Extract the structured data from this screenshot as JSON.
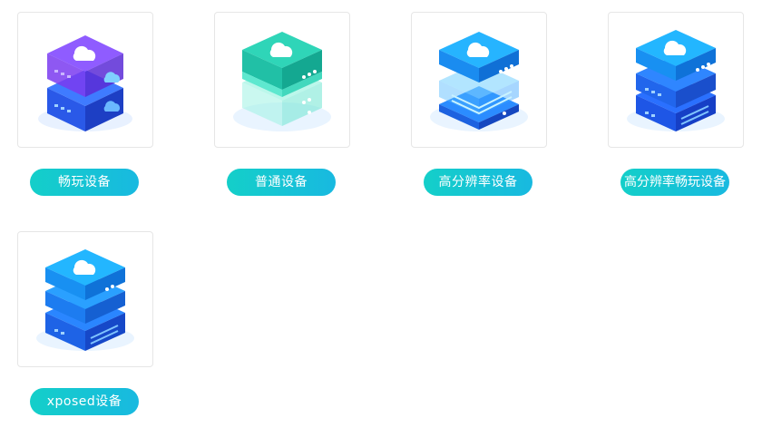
{
  "devices": [
    {
      "label": "畅玩设备",
      "icon": "server-cube-purple-icon"
    },
    {
      "label": "普通设备",
      "icon": "server-cube-teal-icon"
    },
    {
      "label": "高分辨率设备",
      "icon": "server-cube-highres-icon"
    },
    {
      "label": "高分辨率畅玩设备",
      "icon": "server-cube-highres-play-icon"
    },
    {
      "label": "xposed设备",
      "icon": "server-cube-xposed-icon"
    }
  ],
  "colors": {
    "pill_start": "#14cfc9",
    "pill_end": "#18b9e0",
    "card_border": "#e6e6e6"
  }
}
